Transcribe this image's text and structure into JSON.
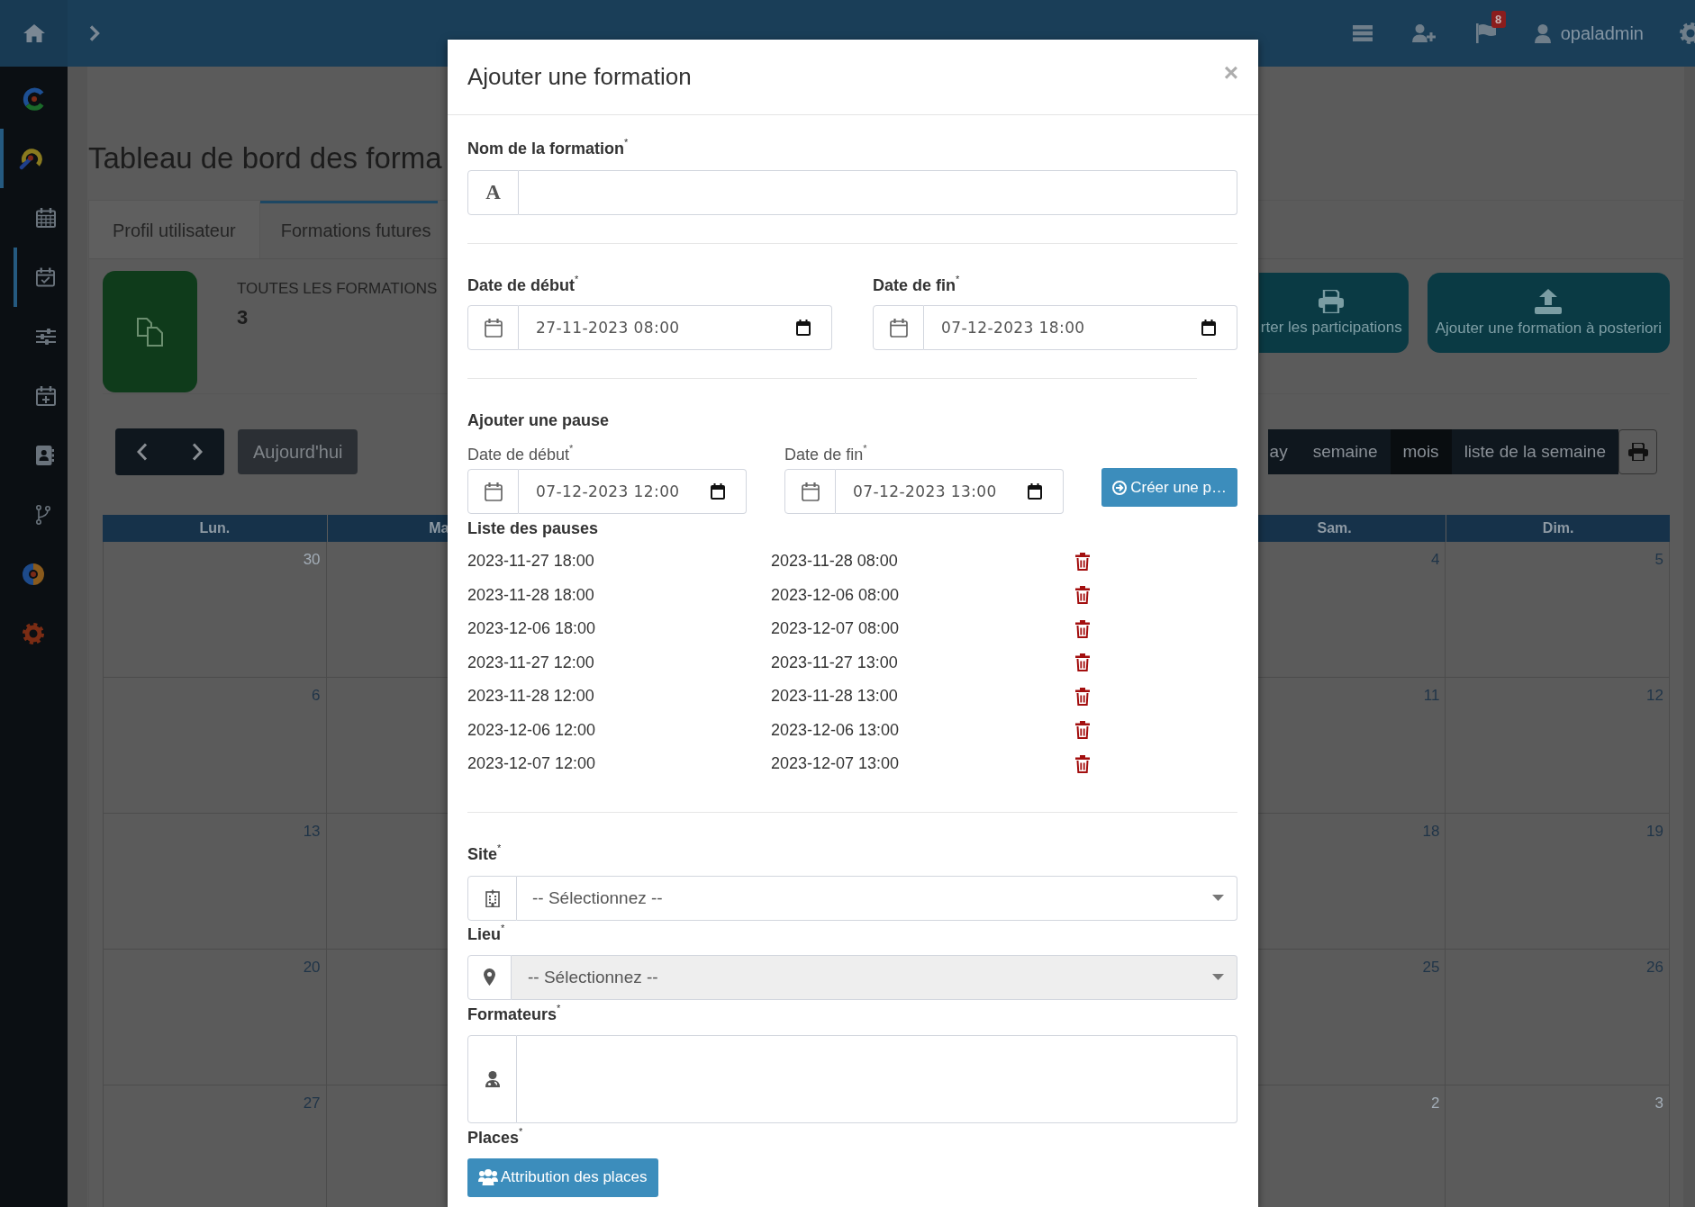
{
  "topbar": {
    "badge": "8",
    "user": "opaladmin"
  },
  "sidebar": {
    "items": [
      {
        "kind": "c-logo",
        "selected": false
      },
      {
        "kind": "arc-logo",
        "selected": true,
        "children": [
          {
            "kind": "calendar",
            "selected": false
          },
          {
            "kind": "calendar-check",
            "selected": true
          },
          {
            "kind": "sliders",
            "selected": false
          },
          {
            "kind": "calendar-plus",
            "selected": false
          },
          {
            "kind": "contact",
            "selected": false
          },
          {
            "kind": "branch",
            "selected": false
          }
        ]
      },
      {
        "kind": "donut-logo",
        "selected": false
      },
      {
        "kind": "gear",
        "selected": false
      }
    ]
  },
  "page": {
    "title": "Tableau de bord des forma",
    "tabs": [
      {
        "label": "Profil utilisateur",
        "selected": false
      },
      {
        "label": "Formations futures",
        "selected": true
      }
    ],
    "stat": {
      "label": "TOUTES LES FORMATIONS",
      "value": "3"
    },
    "actions": [
      {
        "kind": "print",
        "label": "rter les participations"
      },
      {
        "kind": "upload",
        "label": "Ajouter une formation à posteriori"
      }
    ],
    "calendar": {
      "today": "Aujourd'hui",
      "views": [
        {
          "label": "ay",
          "selected": false
        },
        {
          "label": "semaine",
          "selected": false
        },
        {
          "label": "mois",
          "selected": true
        },
        {
          "label": "liste de la semaine",
          "selected": false
        }
      ],
      "columns": [
        {
          "label": "Lun.",
          "days": [
            {
              "label": "30",
              "other_month": true
            },
            {
              "label": "6",
              "other_month": false
            },
            {
              "label": "13",
              "other_month": false
            },
            {
              "label": "20",
              "other_month": false
            },
            {
              "label": "27",
              "other_month": false
            }
          ]
        },
        {
          "label": "Ma"
        },
        {
          "label": "Sam.",
          "days": [
            {
              "label": "4",
              "other_month": false
            },
            {
              "label": "11",
              "other_month": false
            },
            {
              "label": "18",
              "other_month": false
            },
            {
              "label": "25",
              "other_month": false
            },
            {
              "label": "2",
              "other_month": true
            }
          ]
        },
        {
          "label": "Dim.",
          "days": [
            {
              "label": "5",
              "other_month": false
            },
            {
              "label": "12",
              "other_month": false
            },
            {
              "label": "19",
              "other_month": false
            },
            {
              "label": "26",
              "other_month": false
            },
            {
              "label": "3",
              "other_month": true
            }
          ]
        }
      ]
    }
  },
  "modal": {
    "title": "Ajouter une formation",
    "close": "×",
    "name_field": {
      "label": "Nom de la formation$^{*}$",
      "addon": "A"
    },
    "dates": [
      {
        "label": "Date de début$^{*}$",
        "value": "27-11-2023 08:00"
      },
      {
        "label": "Date de fin$^{*}$",
        "value": "07-12-2023 18:00"
      }
    ],
    "pause_form": {
      "title": "Ajouter une pause",
      "dates": [
        {
          "label": "Date de début$^{*}$",
          "value": "07-12-2023 12:00"
        },
        {
          "label": "Date de fin$^{*}$",
          "value": "07-12-2023 13:00"
        }
      ],
      "button": "Créer une p…"
    },
    "pause_list": {
      "title": "Liste des pauses",
      "rows": [
        {
          "start": "2023-11-27 18:00",
          "end": "2023-11-28 08:00"
        },
        {
          "start": "2023-11-28 18:00",
          "end": "2023-12-06 08:00"
        },
        {
          "start": "2023-12-06 18:00",
          "end": "2023-12-07 08:00"
        },
        {
          "start": "2023-11-27 12:00",
          "end": "2023-11-27 13:00"
        },
        {
          "start": "2023-11-28 12:00",
          "end": "2023-11-28 13:00"
        },
        {
          "start": "2023-12-06 12:00",
          "end": "2023-12-06 13:00"
        },
        {
          "start": "2023-12-07 12:00",
          "end": "2023-12-07 13:00"
        }
      ]
    },
    "site": {
      "label": "Site$^{*}$",
      "value": "-- Sélectionnez --",
      "disabled": false
    },
    "lieu": {
      "label": "Lieu$^{*}$",
      "value": "-- Sélectionnez --",
      "disabled": true
    },
    "formateurs": {
      "label": "Formateurs$^{*}$"
    },
    "places": {
      "label": "Places$^{*}$",
      "button": "Attribution des places"
    }
  }
}
